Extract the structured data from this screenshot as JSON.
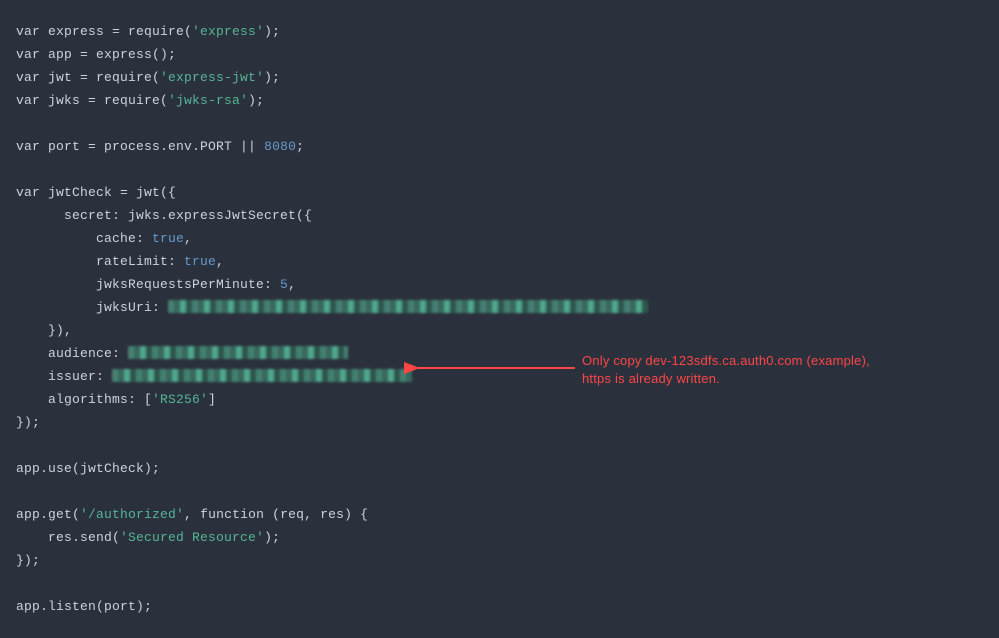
{
  "code": {
    "l1": {
      "kw": "var",
      "v": " express = require(",
      "s": "'express'",
      "e": ");"
    },
    "l2": {
      "kw": "var",
      "v": " app = express();"
    },
    "l3": {
      "kw": "var",
      "v": " jwt = require(",
      "s": "'express-jwt'",
      "e": ");"
    },
    "l4": {
      "kw": "var",
      "v": " jwks = require(",
      "s": "'jwks-rsa'",
      "e": ");"
    },
    "l6": {
      "kw": "var",
      "v": " port = process.env.PORT || ",
      "n": "8080",
      "e": ";"
    },
    "l8": {
      "kw": "var",
      "v": " jwtCheck = jwt({"
    },
    "l9": "      secret: jwks.expressJwtSecret({",
    "l10": {
      "a": "          cache: ",
      "b": "true",
      "c": ","
    },
    "l11": {
      "a": "          rateLimit: ",
      "b": "true",
      "c": ","
    },
    "l12": {
      "a": "          jwksRequestsPerMinute: ",
      "b": "5",
      "c": ","
    },
    "l13a": "          jwksUri: ",
    "l14": "    }),",
    "l15a": "    audience: ",
    "l16a": "    issuer: ",
    "l17": {
      "a": "    algorithms: [",
      "b": "'RS256'",
      "c": "]"
    },
    "l18": "});",
    "l20": "app.use(jwtCheck);",
    "l22": {
      "a": "app.get(",
      "b": "'/authorized'",
      "c": ", ",
      "d": "function",
      "e": " (req, res) {"
    },
    "l23": {
      "a": "    res.send(",
      "b": "'Secured Resource'",
      "c": ");"
    },
    "l24": "});",
    "l26": "app.listen(port);"
  },
  "annotation": {
    "text": "Only copy dev-123sdfs.ca.auth0.com (example),\nhttps is already written."
  }
}
